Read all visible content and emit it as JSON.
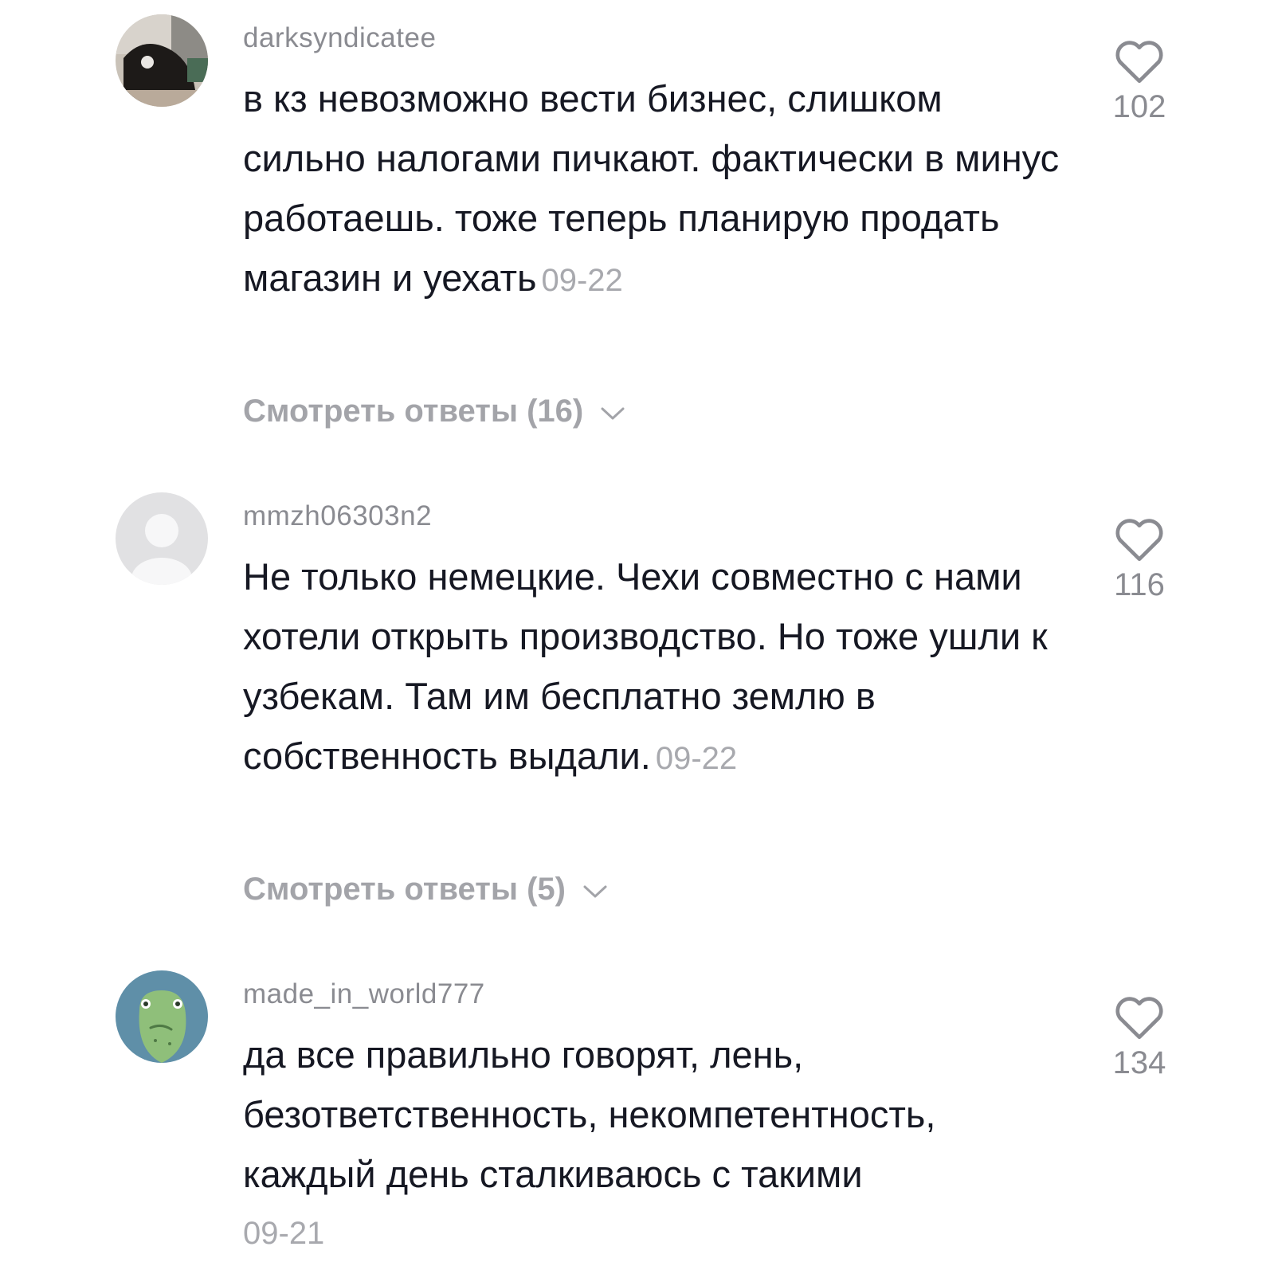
{
  "comments": [
    {
      "username": "darksyndicatee",
      "text": "в кз невозможно вести бизнес, слишком сильно налогами пичкают. фактически в минус работаешь. тоже теперь планирую продать магазин и уехать",
      "date": "09-22",
      "likes": "102",
      "replies_label": "Смотреть ответы (16)"
    },
    {
      "username": "mmzh06303n2",
      "text": "Не только немецкие. Чехи совместно с нами хотели открыть производство. Но тоже ушли к узбекам. Там им бесплатно землю в собственность выдали.",
      "date": "09-22",
      "likes": "116",
      "replies_label": "Смотреть ответы (5)"
    },
    {
      "username": "made_in_world777",
      "text": "да все правильно говорят, лень, безответственность, некомпетентность, каждый день сталкиваюсь с такими",
      "date": "09-21",
      "likes": "134"
    }
  ],
  "icons": {
    "like": "heart-outline-icon",
    "expand": "chevron-down-icon"
  },
  "colors": {
    "text": "#161823",
    "secondary": "#8a8b91",
    "muted": "#a8a9ae"
  }
}
